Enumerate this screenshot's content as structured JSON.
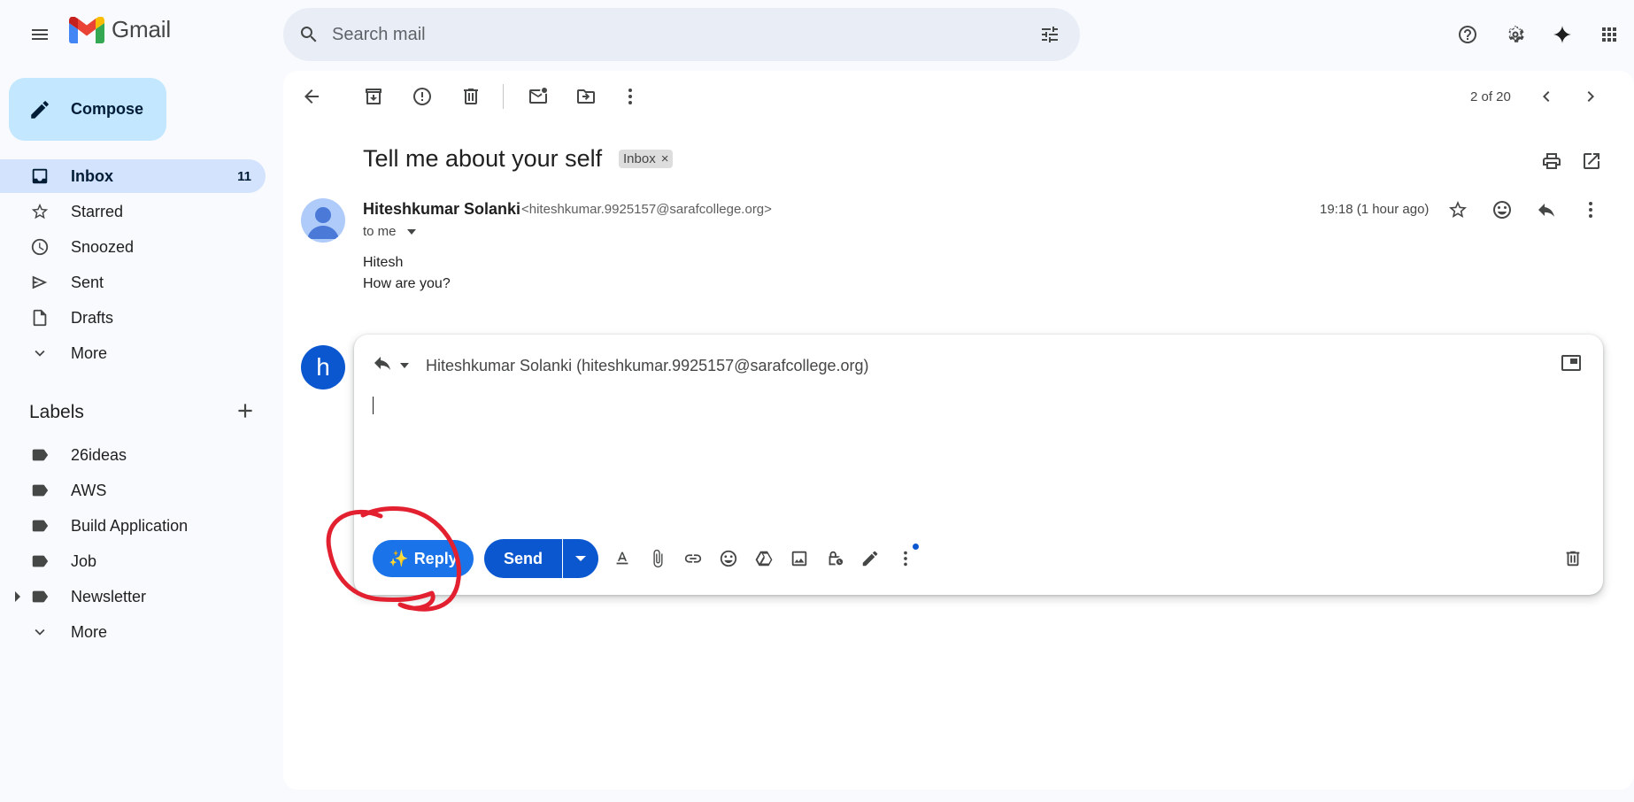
{
  "app": {
    "name": "Gmail"
  },
  "search": {
    "placeholder": "Search mail"
  },
  "sidebar": {
    "compose_label": "Compose",
    "items": [
      {
        "label": "Inbox",
        "count": "11",
        "icon": "inbox-icon",
        "active": true
      },
      {
        "label": "Starred",
        "icon": "star-icon"
      },
      {
        "label": "Snoozed",
        "icon": "clock-icon"
      },
      {
        "label": "Sent",
        "icon": "send-icon"
      },
      {
        "label": "Drafts",
        "icon": "draft-icon"
      },
      {
        "label": "More",
        "icon": "chevron-down-icon"
      }
    ],
    "labels_title": "Labels",
    "labels": [
      {
        "label": "26ideas",
        "icon": "label-icon"
      },
      {
        "label": "AWS",
        "icon": "label-icon"
      },
      {
        "label": "Build Application",
        "icon": "label-icon"
      },
      {
        "label": "Job",
        "icon": "label-icon"
      },
      {
        "label": "Newsletter",
        "icon": "label-icon",
        "expandable": true
      },
      {
        "label": "More",
        "icon": "chevron-down-icon"
      }
    ]
  },
  "toolbar": {
    "page_count": "2 of 20"
  },
  "email": {
    "subject": "Tell me about your self",
    "chip_label": "Inbox",
    "chip_close": "×",
    "sender_name": "Hiteshkumar Solanki",
    "sender_email": "<hiteshkumar.9925157@sarafcollege.org>",
    "recipient_line": "to me",
    "time": "19:18 (1 hour ago)",
    "body": [
      "Hitesh",
      "How are you?"
    ]
  },
  "reply": {
    "avatar_letter": "h",
    "recipient": "Hiteshkumar Solanki (hiteshkumar.9925157@sarafcollege.org)",
    "body_value": "",
    "ai_reply_label": "Reply",
    "ai_reply_icon": "✨",
    "send_label": "Send"
  },
  "colors": {
    "accent": "#0b57d0",
    "compose_bg": "#c2e7ff",
    "active_nav_bg": "#d3e3fd",
    "annotation": "#e3202f"
  }
}
